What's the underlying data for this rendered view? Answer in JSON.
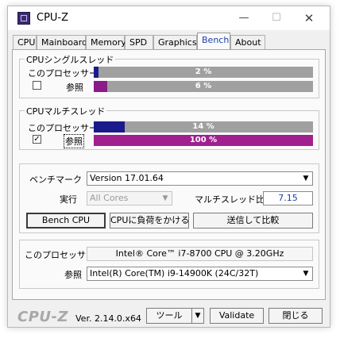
{
  "window": {
    "title": "CPU-Z",
    "minimize": "—",
    "maximize": "☐",
    "close": "✕"
  },
  "tabs": [
    "CPU",
    "Mainboard",
    "Memory",
    "SPD",
    "Graphics",
    "Bench",
    "About"
  ],
  "single": {
    "label": "CPUシングルスレッド",
    "this_label": "このプロセッサー",
    "this_pct": "2 %",
    "this_value": 0.02,
    "ref_label": "参照",
    "ref_pct": "6 %",
    "ref_value": 0.06,
    "ref_checked": false
  },
  "multi": {
    "label": "CPUマルチスレッド",
    "this_label": "このプロセッサー",
    "this_pct": "14 %",
    "this_value": 0.14,
    "ref_label": "参照",
    "ref_pct": "100 %",
    "ref_value": 1.0,
    "ref_checked": true,
    "check_mark": "✓"
  },
  "bench": {
    "bench_label": "ベンチマーク",
    "bench_value": "Version 17.01.64",
    "run_label": "実行",
    "run_value": "All Cores",
    "ratio_label": "マルチスレッド比",
    "ratio_value": "7.15",
    "bench_cpu_btn": "Bench CPU",
    "stress_btn": "CPUに負荷をかける",
    "submit_btn": "送信して比較"
  },
  "processor": {
    "this_label": "このプロセッサー",
    "this_value": "Intel® Core™ i7-8700 CPU @ 3.20GHz",
    "ref_label": "参照",
    "ref_value": "Intel(R) Core(TM) i9-14900K (24C/32T)"
  },
  "footer": {
    "logo": "CPU-Z",
    "version": "Ver. 2.14.0.x64",
    "tools_btn": "ツール",
    "validate_btn": "Validate",
    "close_btn": "閉じる",
    "arrow": "▼"
  },
  "colors": {
    "this_bar": "#1a1a8c",
    "ref_bar": "#8b1a8b",
    "ref_bar_multi": "#a0208f"
  }
}
